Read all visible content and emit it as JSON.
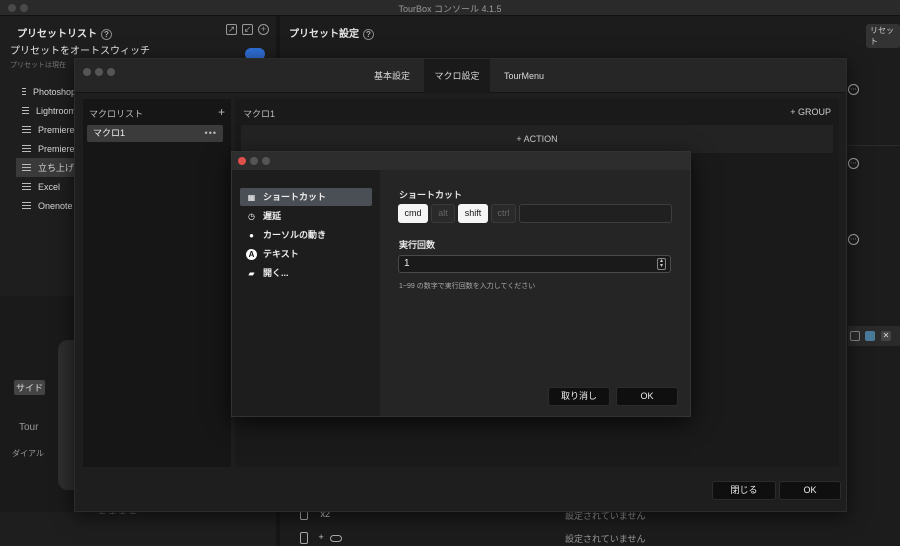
{
  "app": {
    "title": "TourBox コンソール 4.1.5"
  },
  "left": {
    "header": "プリセットリスト",
    "help": "?",
    "autoswitch_title": "プリセットをオートスウィッチ",
    "autoswitch_sub": "プリセットは現在",
    "presets": [
      {
        "label": "Photoshop"
      },
      {
        "label": "Lightroom"
      },
      {
        "label": "Premiere"
      },
      {
        "label": "Premiere"
      },
      {
        "label": "立ち上げ"
      },
      {
        "label": "Excel"
      },
      {
        "label": "Onenote"
      }
    ],
    "device": {
      "side": "サイド",
      "tour": "Tour",
      "dial": "ダイアル"
    }
  },
  "right": {
    "header": "プリセット設定",
    "help": "?",
    "reset": "リセット",
    "rows": [
      {
        "button": "x2",
        "status": "設定されていません"
      },
      {
        "button": "+",
        "status": "設定されていません"
      }
    ]
  },
  "macro": {
    "tabs": [
      {
        "label": "基本設定"
      },
      {
        "label": "マクロ設定"
      },
      {
        "label": "TourMenu"
      }
    ],
    "list_header": "マクロリスト",
    "add": "+",
    "item": "マクロ1",
    "item_more": "•••",
    "main_header": "マクロ1",
    "group_button": "+ GROUP",
    "action_button": "+ ACTION",
    "close_button": "閉じる",
    "ok_button": "OK"
  },
  "dialog": {
    "types": [
      {
        "label": "ショートカット",
        "icon": "keyboard-icon"
      },
      {
        "label": "遅延",
        "icon": "stopwatch-icon"
      },
      {
        "label": "カーソルの動き",
        "icon": "mouse-icon"
      },
      {
        "label": "テキスト",
        "icon": "text-a-icon"
      },
      {
        "label": "開く...",
        "icon": "folder-icon"
      }
    ],
    "shortcut_label": "ショートカット",
    "keys": [
      {
        "label": "cmd",
        "active": true
      },
      {
        "label": "alt",
        "active": false
      },
      {
        "label": "shift",
        "active": true
      },
      {
        "label": "ctrl",
        "active": false
      }
    ],
    "key_value": "",
    "repeat_label": "実行回数",
    "repeat_value": "1",
    "repeat_hint": "1~99 の数字で実行回数を入力してください",
    "cancel_button": "取り消し",
    "ok_button": "OK"
  }
}
